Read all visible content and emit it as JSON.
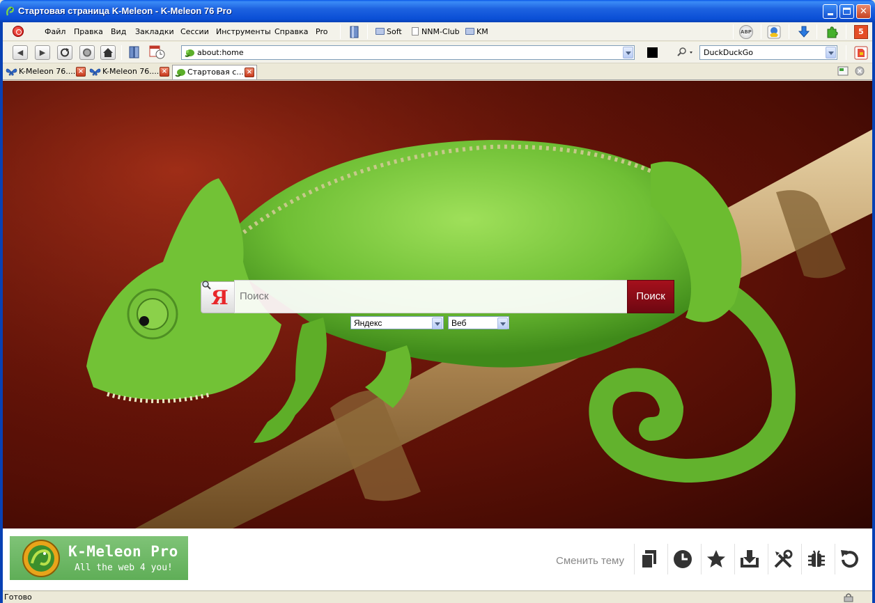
{
  "window": {
    "title": "Стартовая страница K-Meleon - K-Meleon 76 Pro",
    "minimize": "–",
    "maximize": "□",
    "close": "✕"
  },
  "menu": {
    "items": [
      "Файл",
      "Правка",
      "Вид",
      "Закладки",
      "Сессии",
      "Инструменты",
      "Справка",
      "Pro"
    ]
  },
  "bookmarks": [
    {
      "label": "Soft",
      "icon": "folder-icon"
    },
    {
      "label": "NNM-Club",
      "icon": "page-icon"
    },
    {
      "label": "KM",
      "icon": "folder-icon"
    }
  ],
  "toolbar_icons": {
    "abp": "ABP",
    "html5": "5"
  },
  "nav": {
    "back": "◀",
    "forward": "▶",
    "url": "about:home",
    "search_engine": "DuckDuckGo"
  },
  "tabs": [
    {
      "label": "K-Meleon 76....",
      "active": false
    },
    {
      "label": "K-Meleon 76....",
      "active": false
    },
    {
      "label": "Стартовая с...",
      "active": true
    }
  ],
  "page": {
    "search_logo": "Я",
    "search_placeholder": "Поиск",
    "search_button": "Поиск",
    "engine_select": "Яндекс",
    "type_select": "Веб",
    "brand_title": "K-Meleon Pro",
    "brand_subtitle": "All the web 4 you!",
    "change_theme": "Сменить тему"
  },
  "status": {
    "text": "Готово"
  },
  "colors": {
    "titlebar": "#0a4fd6",
    "search_button": "#8b0b16",
    "brand_green": "#6db865"
  }
}
